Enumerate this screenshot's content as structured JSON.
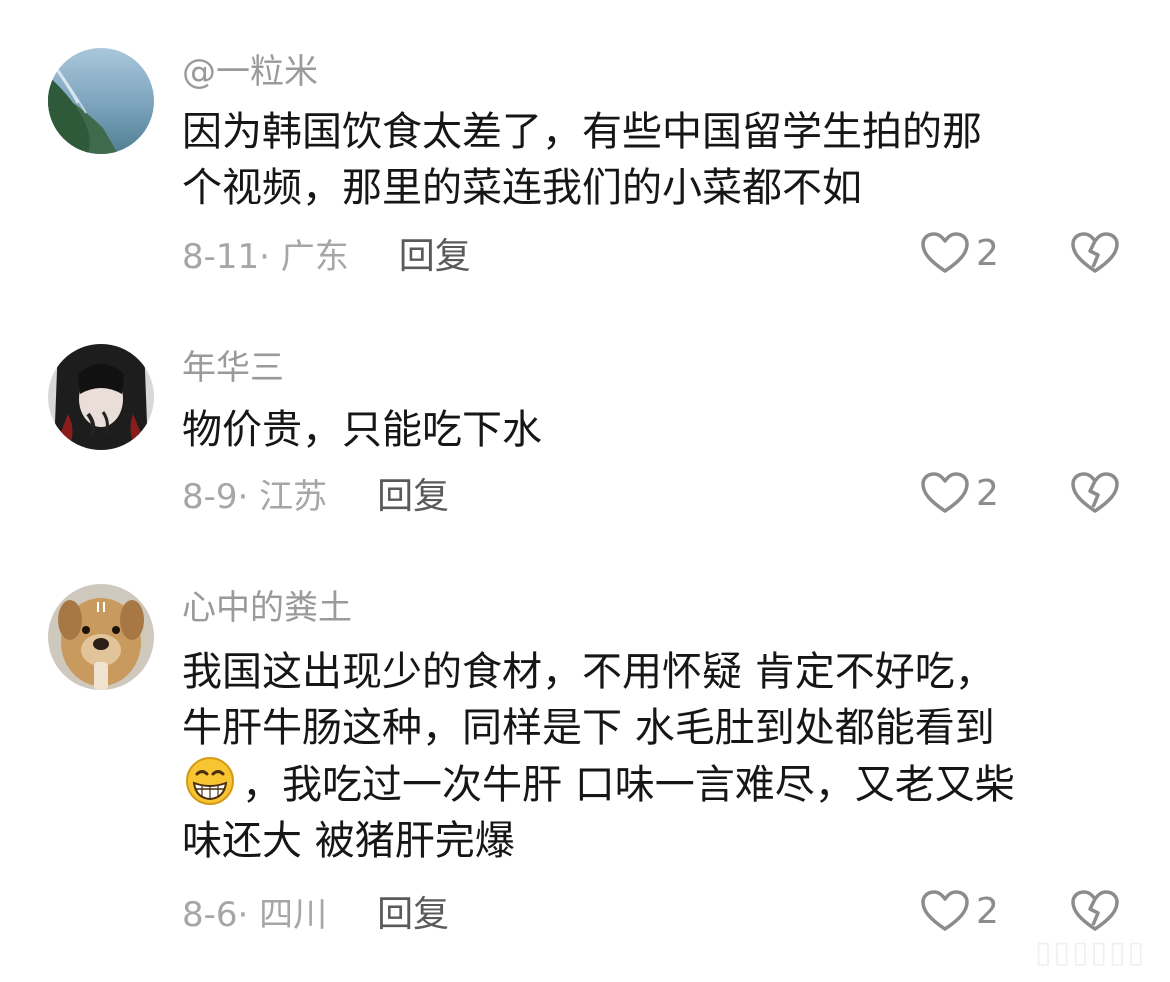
{
  "comments": [
    {
      "username": "@一粒米",
      "lines": [
        "因为韩国饮食太差了，有些中国留学生拍的那",
        "个视频，那里的菜连我们的小菜都不如"
      ],
      "date_location": "8-11· 广东",
      "reply_label": "回复",
      "likes": "2",
      "avatar": "ocean-coastline-avatar"
    },
    {
      "username": "年华三",
      "lines": [
        "物价贵，只能吃下水"
      ],
      "date_location": "8-9· 江苏",
      "reply_label": "回复",
      "likes": "2",
      "avatar": "dark-hair-figure-avatar"
    },
    {
      "username": "心中的粪土",
      "lines": [
        "我国这出现少的食材，不用怀疑 肯定不好吃，",
        "牛肝牛肠这种，同样是下 水毛肚到处都能看到",
        "，我吃过一次牛肝 口味一言难尽，又老又柴",
        "味还大 被猪肝完爆"
      ],
      "emoji": "grinning-face-emoji",
      "date_location": "8-6· 四川",
      "reply_label": "回复",
      "likes": "2",
      "avatar": "dog-praying-avatar"
    }
  ],
  "watermark": "▯▯▯▯▯▯",
  "colors": {
    "username": "#9a9a9a",
    "text": "#161616",
    "meta": "#a6a6a6",
    "reply": "#5a5a5a",
    "icon": "#8c8c8c"
  }
}
